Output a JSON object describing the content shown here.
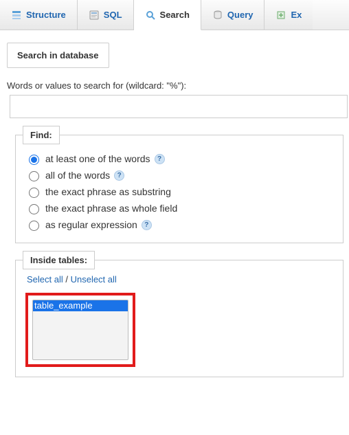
{
  "tabs": {
    "structure": "Structure",
    "sql": "SQL",
    "search": "Search",
    "query": "Query",
    "extra": "Ex"
  },
  "panel_title": "Search in database",
  "search_prompt": "Words or values to search for (wildcard: \"%\"):",
  "find": {
    "legend": "Find:",
    "opt_atleast": "at least one of the words",
    "opt_all": "all of the words",
    "opt_substring": "the exact phrase as substring",
    "opt_wholefield": "the exact phrase as whole field",
    "opt_regex": "as regular expression"
  },
  "tables": {
    "legend": "Inside tables:",
    "select_all": "Select all",
    "unselect_all": "Unselect all",
    "separator": " / ",
    "item0": "table_example"
  }
}
